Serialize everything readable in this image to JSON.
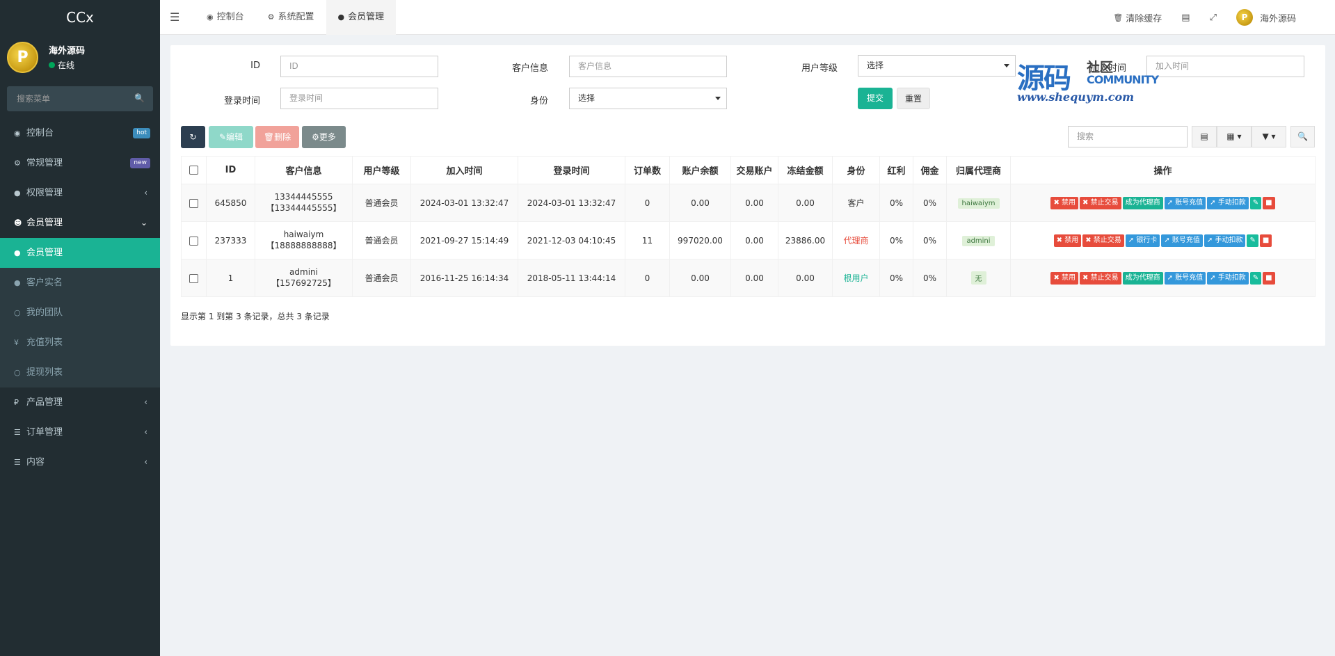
{
  "app_name": "CCx",
  "user": {
    "name": "海外源码",
    "status": "在线",
    "avatar_letter": "P"
  },
  "sidebar": {
    "search_placeholder": "搜索菜单",
    "items": [
      {
        "label": "控制台",
        "icon": "dashboard-icon",
        "badge": "hot"
      },
      {
        "label": "常规管理",
        "icon": "cogs-icon",
        "badge": "new"
      },
      {
        "label": "权限管理",
        "icon": "users-icon"
      },
      {
        "label": "会员管理",
        "icon": "user-circle-icon"
      },
      {
        "label": "会员管理",
        "icon": "user-icon"
      },
      {
        "label": "客户实名",
        "icon": "user-icon"
      },
      {
        "label": "我的团队",
        "icon": "circle-icon"
      },
      {
        "label": "充值列表",
        "icon": "yen-icon"
      },
      {
        "label": "提现列表",
        "icon": "circle-icon"
      },
      {
        "label": "产品管理",
        "icon": "ruble-icon"
      },
      {
        "label": "订单管理",
        "icon": "list-icon"
      },
      {
        "label": "内容",
        "icon": "list-icon"
      }
    ]
  },
  "header": {
    "tabs": [
      "控制台",
      "系统配置",
      "会员管理"
    ],
    "clear_cache": "清除缓存",
    "username": "海外源码"
  },
  "filters": {
    "id_label": "ID",
    "id_placeholder": "ID",
    "customer_label": "客户信息",
    "customer_placeholder": "客户信息",
    "level_label": "用户等级",
    "level_value": "选择",
    "join_label": "加入时间",
    "join_placeholder": "加入时间",
    "login_label": "登录时间",
    "login_placeholder": "登录时间",
    "identity_label": "身份",
    "identity_value": "选择",
    "submit": "提交",
    "reset": "重置"
  },
  "watermark": {
    "big": "源码",
    "small1": "社区",
    "small2": "COMMUNITY",
    "url": "www.shequym.com"
  },
  "toolbar": {
    "edit": "编辑",
    "delete": "删除",
    "more": "更多",
    "search_placeholder": "搜索"
  },
  "table": {
    "headers": [
      "ID",
      "客户信息",
      "用户等级",
      "加入时间",
      "登录时间",
      "订单数",
      "账户余额",
      "交易账户",
      "冻结金额",
      "身份",
      "红利",
      "佣金",
      "归属代理商",
      "操作"
    ],
    "rows": [
      {
        "id": "645850",
        "info1": "13344445555",
        "info2": "【13344445555】",
        "level": "普通会员",
        "join": "2024-03-01 13:32:47",
        "login": "2024-03-01 13:32:47",
        "orders": "0",
        "balance": "0.00",
        "trade": "0.00",
        "frozen": "0.00",
        "identity": "客户",
        "bonus": "0%",
        "commission": "0%",
        "agent": "haiwaiym",
        "actions": [
          "禁用",
          "禁止交易",
          "成为代理商",
          "账号充值",
          "手动扣款"
        ]
      },
      {
        "id": "237333",
        "info1": "haiwaiym",
        "info2": "【18888888888】",
        "level": "普通会员",
        "join": "2021-09-27 15:14:49",
        "login": "2021-12-03 04:10:45",
        "orders": "11",
        "balance": "997020.00",
        "trade": "0.00",
        "frozen": "23886.00",
        "identity": "代理商",
        "bonus": "0%",
        "commission": "0%",
        "agent": "admini",
        "actions": [
          "禁用",
          "禁止交易",
          "银行卡",
          "账号充值",
          "手动扣款"
        ]
      },
      {
        "id": "1",
        "info1": "admini",
        "info2": "【157692725】",
        "level": "普通会员",
        "join": "2016-11-25 16:14:34",
        "login": "2018-05-11 13:44:14",
        "orders": "0",
        "balance": "0.00",
        "trade": "0.00",
        "frozen": "0.00",
        "identity": "根用户",
        "bonus": "0%",
        "commission": "0%",
        "agent": "无",
        "actions": [
          "禁用",
          "禁止交易",
          "成为代理商",
          "账号充值",
          "手动扣款"
        ]
      }
    ]
  },
  "pager_text": "显示第 1 到第 3 条记录，总共 3 条记录",
  "colors": {
    "sidebar_bg": "#222d32",
    "accent": "#1ab394",
    "danger": "#e74c3c",
    "info": "#3498db"
  }
}
